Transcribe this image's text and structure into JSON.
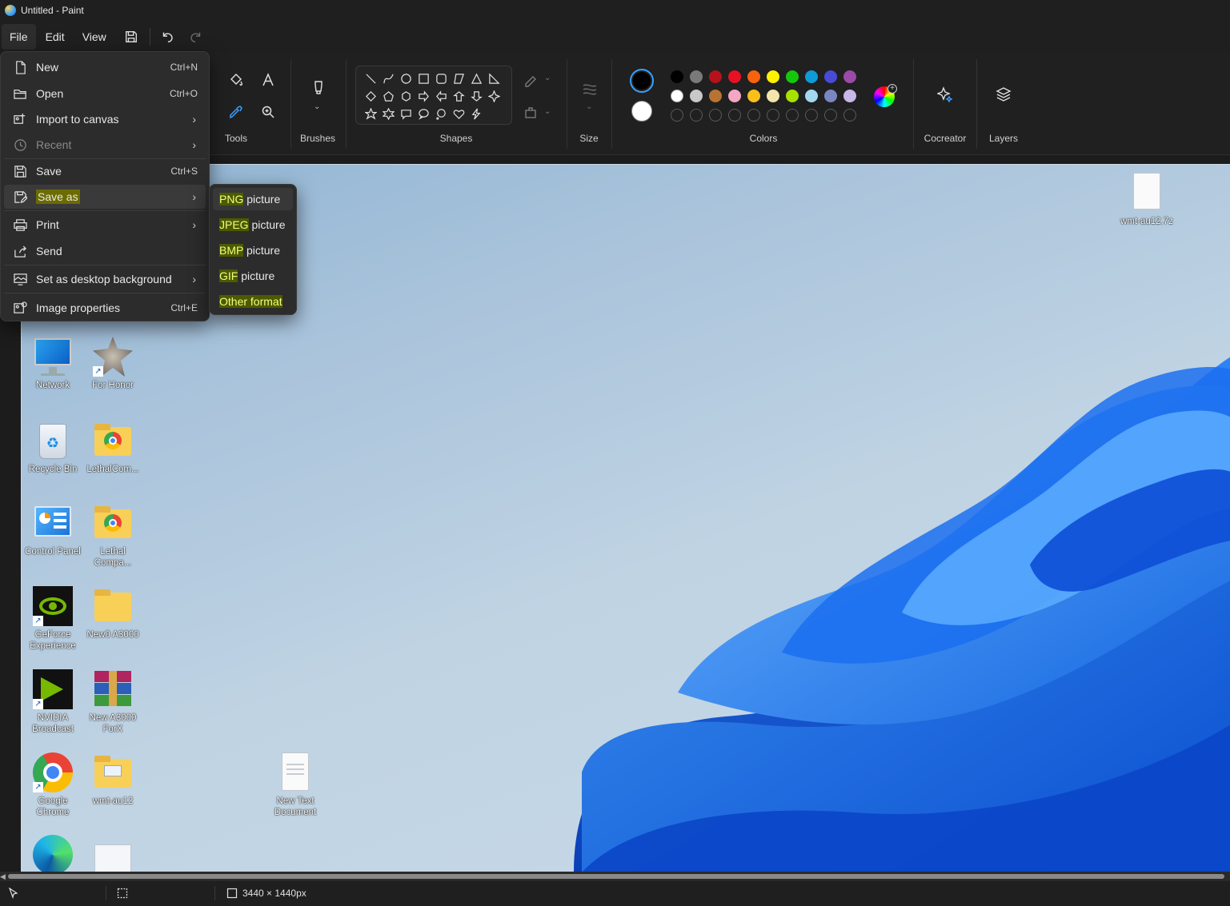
{
  "window": {
    "title": "Untitled - Paint"
  },
  "menubar": {
    "file": "File",
    "edit": "Edit",
    "view": "View"
  },
  "ribbon": {
    "tools_label": "Tools",
    "brushes_label": "Brushes",
    "shapes_label": "Shapes",
    "size_label": "Size",
    "colors_label": "Colors",
    "cocreator_label": "Cocreator",
    "layers_label": "Layers",
    "colors": {
      "row1": [
        "#000000",
        "#7a7a7a",
        "#b5121b",
        "#e81123",
        "#f7630c",
        "#fff100",
        "#16c60c",
        "#0f9bd7",
        "#4a4ad8",
        "#9b4aa8"
      ],
      "row2": [
        "#ffffff",
        "#c8c8c8",
        "#b87333",
        "#f4a7c3",
        "#f9c01a",
        "#f3e5ab",
        "#a8e000",
        "#a3d8ef",
        "#7a86c2",
        "#c8b8e8"
      ]
    },
    "primary_color": "#000000",
    "secondary_color": "#ffffff"
  },
  "file_menu": {
    "items": [
      {
        "label": "New",
        "shortcut": "Ctrl+N",
        "icon": "new-file-icon"
      },
      {
        "label": "Open",
        "shortcut": "Ctrl+O",
        "icon": "folder-open-icon"
      },
      {
        "label": "Import to canvas",
        "shortcut": "",
        "icon": "import-image-icon"
      },
      {
        "label": "Recent",
        "shortcut": "",
        "icon": "clock-icon"
      },
      {
        "label": "Save",
        "shortcut": "Ctrl+S",
        "icon": "save-icon"
      },
      {
        "label": "Save as",
        "shortcut": "",
        "icon": "save-as-icon"
      },
      {
        "label": "Print",
        "shortcut": "",
        "icon": "printer-icon"
      },
      {
        "label": "Send",
        "shortcut": "",
        "icon": "share-icon"
      },
      {
        "label": "Set as desktop background",
        "shortcut": "",
        "icon": "desktop-background-icon"
      },
      {
        "label": "Image properties",
        "shortcut": "Ctrl+E",
        "icon": "image-properties-icon"
      }
    ]
  },
  "save_as_submenu": {
    "png_a": "PNG",
    "png_b": " picture",
    "jpeg_a": "JPEG",
    "jpeg_b": " picture",
    "bmp_a": "BMP",
    "bmp_b": " picture",
    "gif_a": "GIF",
    "gif_b": " picture",
    "other": "Other format"
  },
  "desktop_icons": {
    "network": "Network",
    "for_honor": "For Honor",
    "recycle_bin": "Recycle Bin",
    "lethalcom": "LethalCom...",
    "control_panel": "Control Panel",
    "lethal_compa": "Lethal Compa...",
    "geforce": "GeForce Experience",
    "new0_a3000": "New0 A3000",
    "nvidia_broadcast": "NVIDIA Broadcast",
    "new_a3000_forx": "New A3000 ForX",
    "google_chrome": "Google Chrome",
    "wmt_au12": "wmt-au12",
    "new_text_document": "New Text Document",
    "wmt_au12_7z": "wmt-au12.7z"
  },
  "status": {
    "canvas_size": "3440 × 1440px"
  }
}
